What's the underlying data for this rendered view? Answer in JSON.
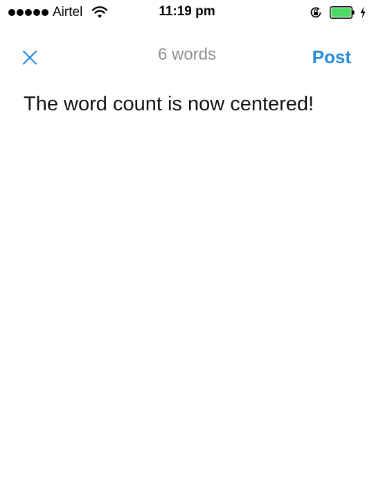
{
  "status_bar": {
    "carrier": "Airtel",
    "time": "11:19 pm",
    "signal_bars": 5,
    "battery_level": 1.0,
    "icons": [
      "signal-icon",
      "wifi-icon",
      "rotation-lock-icon",
      "battery-icon",
      "charging-icon"
    ]
  },
  "nav": {
    "close_icon": "close-icon",
    "word_count": "6 words",
    "post_label": "Post"
  },
  "compose": {
    "text": "The word count is now centered!"
  },
  "colors": {
    "accent": "#2a8bdb",
    "word_count": "#8e8e93",
    "battery_fill": "#4cd964",
    "text": "#111111"
  }
}
